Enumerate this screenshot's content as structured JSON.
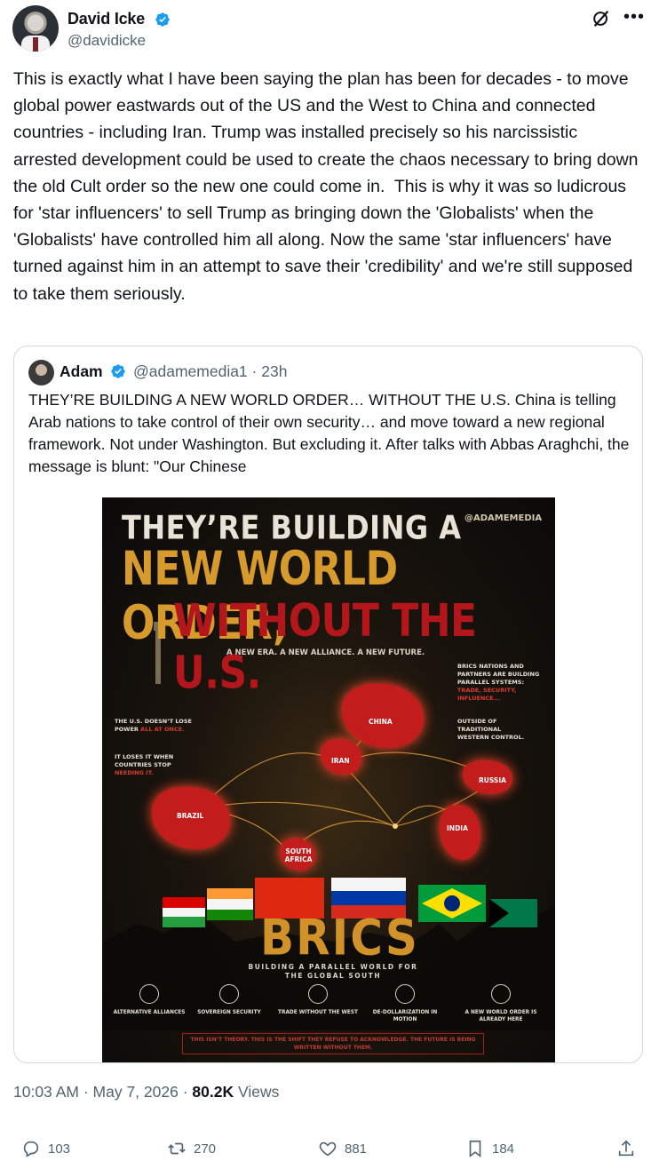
{
  "author": {
    "name": "David Icke",
    "handle": "@davidicke"
  },
  "post": {
    "text": "This is exactly what I have been saying the plan has been for decades - to move global power eastwards out of the US and the West to China and connected countries - including Iran. Trump was installed precisely so his narcissistic arrested development could be used to create the chaos necessary to bring down the old Cult order so the new one could come in.  This is why it was so ludicrous for 'star influencers' to sell Trump as bringing down the 'Globalists' when the 'Globalists' have controlled him all along. Now the same 'star influencers' have turned against him in an attempt to save their 'credibility' and we're still supposed to take them seriously.",
    "time": "10:03 AM",
    "date": "May 7, 2026",
    "views_count": "80.2K",
    "views_label": "Views"
  },
  "quote": {
    "name": "Adam",
    "handle": "@adamemedia1",
    "age": "23h",
    "text": "THEY’RE BUILDING A NEW WORLD ORDER… WITHOUT THE U.S. China is telling Arab nations to take control of their own security… and move toward a new regional framework. Not under Washington. But excluding it. After talks with Abbas Araghchi, the message is blunt: \"Our Chinese",
    "poster": {
      "line1": "THEY’RE BUILDING A",
      "line2": "NEW WORLD ORDER,",
      "line3": "WITHOUT THE U.S.",
      "brand": "@ADAMEMEDIA",
      "tagline": "A NEW ERA. A NEW ALLIANCE. A NEW FUTURE.",
      "brics_note_a": "BRICS NATIONS AND PARTNERS ARE BUILDING PARALLEL SYSTEMS:",
      "brics_note_b": "TRADE, SECURITY, INFLUENCE...",
      "outside": "OUTSIDE OF TRADITIONAL WESTERN CONTROL.",
      "left1_a": "THE U.S. DOESN’T LOSE POWER",
      "left1_b": "ALL AT ONCE.",
      "left2_a": "IT LOSES IT WHEN COUNTRIES STOP",
      "left2_b": "NEEDING IT.",
      "countries": {
        "china": "CHINA",
        "iran": "IRAN",
        "russia": "RUSSIA",
        "brazil": "BRAZIL",
        "india": "INDIA",
        "south_africa": "SOUTH AFRICA"
      },
      "brics": "BRICS",
      "subtitle": "BUILDING A PARALLEL WORLD FOR THE GLOBAL SOUTH",
      "pillars": [
        "ALTERNATIVE ALLIANCES",
        "SOVEREIGN SECURITY",
        "TRADE WITHOUT THE WEST",
        "DE-DOLLARIZATION IN MOTION",
        "A NEW WORLD ORDER IS ALREADY HERE"
      ],
      "footer": "THIS ISN’T THEORY. THIS IS THE SHIFT THEY REFUSE TO ACKNOWLEDGE. THE FUTURE IS BEING WRITTEN WITHOUT THEM."
    }
  },
  "actions": {
    "replies": "103",
    "reposts": "270",
    "likes": "881",
    "bookmarks": "184"
  },
  "colors": {
    "accent": "#1d9bf0",
    "text": "#0f1419",
    "secondary": "#536471",
    "border": "#cfd9de"
  },
  "icons": [
    "verified-badge-icon",
    "grok-icon",
    "more-icon",
    "reply-icon",
    "repost-icon",
    "like-icon",
    "bookmark-icon",
    "share-icon"
  ]
}
